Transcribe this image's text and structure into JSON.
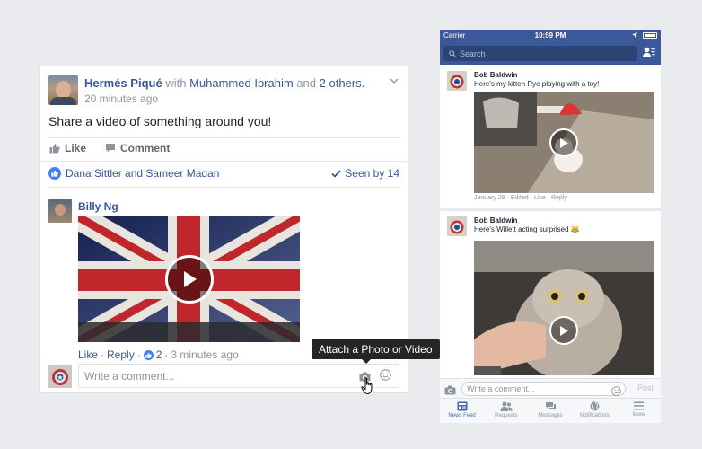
{
  "desktop": {
    "author": "Hermés Piqué",
    "with_word": "with",
    "tagged_friend": "Muhammed Ibrahim",
    "and_word": "and",
    "others": "2 others.",
    "time": "20 minutes ago",
    "post_text": "Share a video of something around you!",
    "like_label": "Like",
    "comment_label": "Comment",
    "likers": "Dana Sittler and Sameer Madan",
    "seen_by": "Seen by 14",
    "comment": {
      "author": "Billy Ng",
      "like": "Like",
      "dot1": "·",
      "reply": "Reply",
      "dot2": "·",
      "like_count": "2",
      "dot3": "·",
      "time": "3 minutes ago"
    },
    "comment_placeholder": "Write a comment...",
    "tooltip": "Attach a Photo or Video"
  },
  "phone": {
    "carrier": "Carrier",
    "clock": "10:59 PM",
    "search_placeholder": "Search",
    "posts": [
      {
        "author": "Bob Baldwin",
        "text": "Here's my kitten Rye playing with a toy!",
        "meta": "January 29 · Edited · Like · Reply"
      },
      {
        "author": "Bob Baldwin",
        "text": "Here's Willett acting surprised 😹"
      }
    ],
    "comment_placeholder": "Write a comment...",
    "post_label": "Post",
    "tabs": [
      "News Feed",
      "Requests",
      "Messages",
      "Notifications",
      "More"
    ]
  },
  "colors": {
    "brand": "#3b5998",
    "link": "#365899",
    "like_blue": "#4080ff",
    "background": "#e9ebee"
  }
}
